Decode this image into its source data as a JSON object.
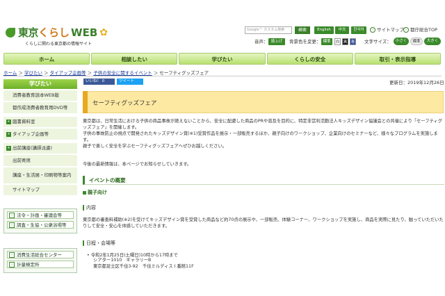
{
  "header": {
    "logo_main": "東京",
    "logo_kurashi": "くらし",
    "logo_web": "WEB",
    "tagline": "くらしに関わる東京都の情報サイト",
    "search_placeholder": "Google™ カスタム検索",
    "search_button": "検索",
    "lang_buttons": [
      "English",
      "中文",
      "한국어"
    ],
    "links": [
      "サイトマップ",
      "都庁総合TOP"
    ],
    "voice_label": "音声：",
    "voice_button": "読上げ",
    "bg_label": "背景色を変更：",
    "bg_options": [
      "標準",
      "白",
      "黒",
      "青"
    ],
    "fontsize_label": "文字サイズ：",
    "fontsize_options": [
      "小さく",
      "標準",
      "大きく"
    ]
  },
  "nav": [
    "ホーム",
    "相談したい",
    "学びたい",
    "くらしの安全",
    "取引・表示指導"
  ],
  "breadcrumb": [
    "ホーム",
    "学びたい",
    "タイアップ企画等",
    "子供の安全に関するイベント",
    "セーフティグッズフェア"
  ],
  "sidebar": {
    "heading": "学びたい",
    "items": [
      {
        "label": "消費者教育読本WEB版",
        "icon": ""
      },
      {
        "label": "都作成消費者教育用DVD等",
        "icon": ""
      },
      {
        "label": "図書資料室",
        "icon": "plus-icon"
      },
      {
        "label": "タイアップ企画等",
        "icon": "plus-icon"
      },
      {
        "label": "出前講座(講師派遣)",
        "icon": "plus-icon"
      },
      {
        "label": "出前寄席",
        "icon": ""
      },
      {
        "label": "講座・生活展・印刷物等案内",
        "icon": ""
      },
      {
        "label": "サイトマップ",
        "icon": ""
      }
    ],
    "box1": [
      "法令・計画・審議会等",
      "調査・生協・公衆浴場等"
    ],
    "box2": [
      "消費生活総合センター",
      "計量検定所"
    ]
  },
  "main": {
    "like_button": "いいね！ 0",
    "tweet_button": "ツイート",
    "updated": "更新日：2019年12月26日",
    "title": "セーフティグッズフェア",
    "intro": [
      "東京都は、日常生活における子供の商品事故が絶えないことから、安全に配慮した商品のPRや普及を目的に、特定非営利活動法人キッズデザイン協議会との共催により「セーフティグッズフェア」を開催します。",
      "子供の事故防止の視点で開発されたキッズデザイン賞(※1)受賞作品を展示・一部販売するほか、親子向けのワークショップ、企業向けのセミナーなど、様々なプログラムを実施します。",
      "親子で楽しく安全を学ぶセーフティグッズフェアへぜひお越しください。"
    ],
    "notice": "今後の最新情報は、本ページでお知らせしていきます。",
    "section_heading": "イベントの概要",
    "sub_heading": "親子向け",
    "content_heading": "内容",
    "content_text": "東京都の審査料補助(※2)を受けてキッズデザイン賞を受賞した商品など約70点の展示や、一部販売、体験コーナー、ワークショップを実施し、商品を実際に見たり、触っていただいたりして安全・安心を体感していただきます。",
    "date_heading": "日程・会場等",
    "date_lines": [
      "令和2年1月25日(土曜日)10時から17時まで",
      "シアター1010　ギャラリーB",
      "東京都足立区千住3-92　千住ミルディス I 番館11F"
    ]
  }
}
